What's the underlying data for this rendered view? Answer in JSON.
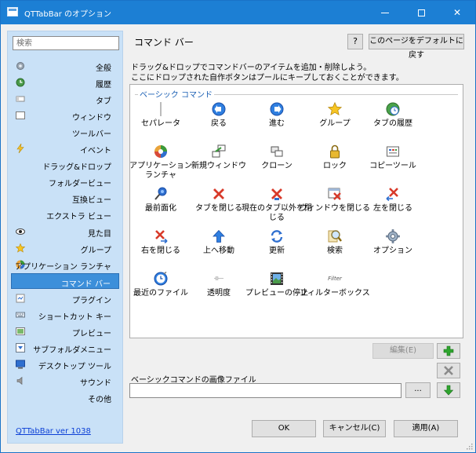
{
  "window": {
    "title": "QTTabBar のオプション",
    "controls": [
      "minimize",
      "maximize",
      "close"
    ]
  },
  "sidebar": {
    "search_placeholder": "検索",
    "items": [
      {
        "label": "全般",
        "icon": "gear-icon"
      },
      {
        "label": "履歴",
        "icon": "history-icon"
      },
      {
        "label": "タブ",
        "icon": "tab-icon"
      },
      {
        "label": "ウィンドウ",
        "icon": "window-icon"
      },
      {
        "label": "ツールバー",
        "icon": ""
      },
      {
        "label": "イベント",
        "icon": "lightning-icon"
      },
      {
        "label": "ドラッグ&ドロップ",
        "icon": ""
      },
      {
        "label": "フォルダービュー",
        "icon": ""
      },
      {
        "label": "互換ビュー",
        "icon": ""
      },
      {
        "label": "エクストラ ビュー",
        "icon": ""
      },
      {
        "label": "見た目",
        "icon": "eye-icon"
      },
      {
        "label": "グループ",
        "icon": "star-icon"
      },
      {
        "label": "アプリケーション ランチャ",
        "icon": "launcher-icon"
      },
      {
        "label": "コマンド バー",
        "icon": "",
        "selected": true
      },
      {
        "label": "プラグイン",
        "icon": "plugin-icon"
      },
      {
        "label": "ショートカット キー",
        "icon": "keyboard-icon"
      },
      {
        "label": "プレビュー",
        "icon": "preview-icon"
      },
      {
        "label": "サブフォルダメニュー",
        "icon": "subfolder-icon"
      },
      {
        "label": "デスクトップ ツール",
        "icon": "desktop-icon"
      },
      {
        "label": "サウンド",
        "icon": "speaker-icon"
      },
      {
        "label": "その他",
        "icon": ""
      }
    ],
    "version_link": "QTTabBar ver 1038"
  },
  "panel": {
    "title": "コマンド バー",
    "help_label": "?",
    "default_button": "このページをデフォルトに戻す",
    "description_line1": "ドラッグ&ドロップでコマンドバーのアイテムを追加・削除しよう。",
    "description_line2": "ここにドロップされた自作ボタンはプールにキープしておくことができます。",
    "group_label": "ベーシック コマンド",
    "commands": [
      {
        "label": "セパレータ",
        "icon": "separator-icon"
      },
      {
        "label": "戻る",
        "icon": "back-icon"
      },
      {
        "label": "進む",
        "icon": "forward-icon"
      },
      {
        "label": "グループ",
        "icon": "star-icon"
      },
      {
        "label": "タブの履歴",
        "icon": "history-icon"
      },
      {
        "label": "アプリケーション ランチャ",
        "icon": "launcher-icon"
      },
      {
        "label": "新規ウィンドウ",
        "icon": "new-window-icon"
      },
      {
        "label": "クローン",
        "icon": "clone-icon"
      },
      {
        "label": "ロック",
        "icon": "lock-icon"
      },
      {
        "label": "コピーツール",
        "icon": "copy-tool-icon"
      },
      {
        "label": "最前面化",
        "icon": "pin-icon"
      },
      {
        "label": "タブを閉じる",
        "icon": "close-tab-icon"
      },
      {
        "label": "現在のタブ以外を閉じる",
        "icon": "close-others-icon"
      },
      {
        "label": "ウィンドウを閉じる",
        "icon": "close-window-icon"
      },
      {
        "label": "左を閉じる",
        "icon": "close-left-icon"
      },
      {
        "label": "右を閉じる",
        "icon": "close-right-icon"
      },
      {
        "label": "上へ移動",
        "icon": "up-arrow-icon"
      },
      {
        "label": "更新",
        "icon": "refresh-icon"
      },
      {
        "label": "検索",
        "icon": "search-icon"
      },
      {
        "label": "オプション",
        "icon": "gear-icon"
      },
      {
        "label": "最近のファイル",
        "icon": "recent-files-icon"
      },
      {
        "label": "透明度",
        "icon": "transparency-icon"
      },
      {
        "label": "プレビューの停止",
        "icon": "film-icon"
      },
      {
        "label": "フィルターボックス",
        "icon": "filter-box-icon"
      }
    ],
    "filter_icon_text": "Filter",
    "edit_button": "編集(E)",
    "image_file_label": "ベーシックコマンドの画像ファイル",
    "image_file_value": "",
    "browse_button": "...",
    "ok_button": "OK",
    "cancel_button": "キャンセル(C)",
    "apply_button": "適用(A)"
  },
  "colors": {
    "titlebar": "#1c7fd4",
    "sidebar_bg": "#c9e1f7",
    "selected_item": "#3c8fda",
    "group_label": "#1a5fb4",
    "link": "#0b3fd6",
    "green_button": "#2ea52e"
  }
}
